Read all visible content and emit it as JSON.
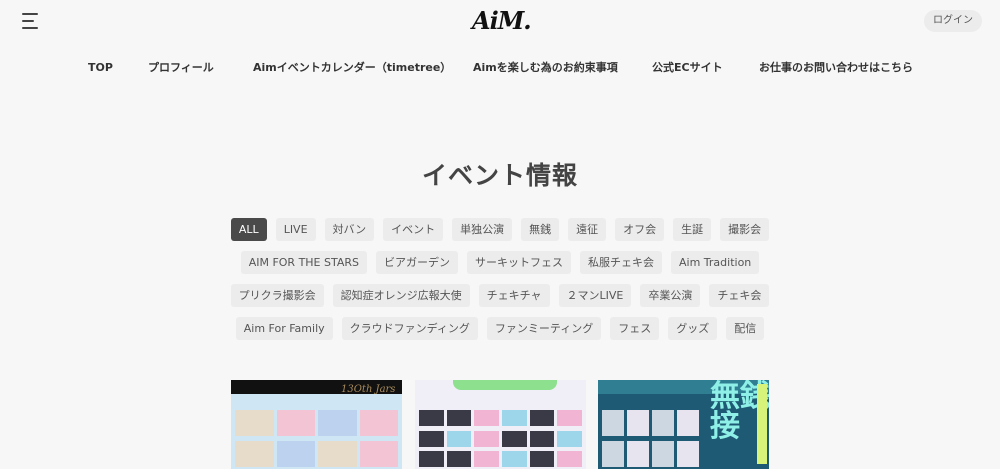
{
  "header": {
    "logo_text": "AiM.",
    "login_label": "ログイン"
  },
  "nav": {
    "items": [
      {
        "label": "TOP"
      },
      {
        "label": "プロフィール"
      },
      {
        "label": "Aimイベントカレンダー（timetree）"
      },
      {
        "label": "Aimを楽しむ為のお約束事項"
      },
      {
        "label": "公式ECサイト"
      },
      {
        "label": "お仕事のお問い合わせはこちら"
      }
    ]
  },
  "main": {
    "title": "イベント情報"
  },
  "filters": {
    "active": "ALL",
    "rows": [
      [
        "ALL",
        "LIVE",
        "対バン",
        "イベント",
        "単独公演",
        "無銭",
        "遠征",
        "オフ会",
        "生誕",
        "撮影会"
      ],
      [
        "AIM FOR THE STARS",
        "ビアガーデン",
        "サーキットフェス",
        "私服チェキ会",
        "Aim Tradition"
      ],
      [
        "プリクラ撮影会",
        "認知症オレンジ広報大使",
        "チェキチャ",
        "２マンLIVE",
        "卒業公演",
        "チェキ会"
      ],
      [
        "Aim For Family",
        "クラウドファンディング",
        "ファンミーティング",
        "フェス",
        "グッズ",
        "配信"
      ]
    ]
  },
  "cards": {
    "card1_banner": "13Oth Jars",
    "card3_banner": "無銭接"
  },
  "icons": {
    "menu": "hamburger-menu-icon"
  }
}
